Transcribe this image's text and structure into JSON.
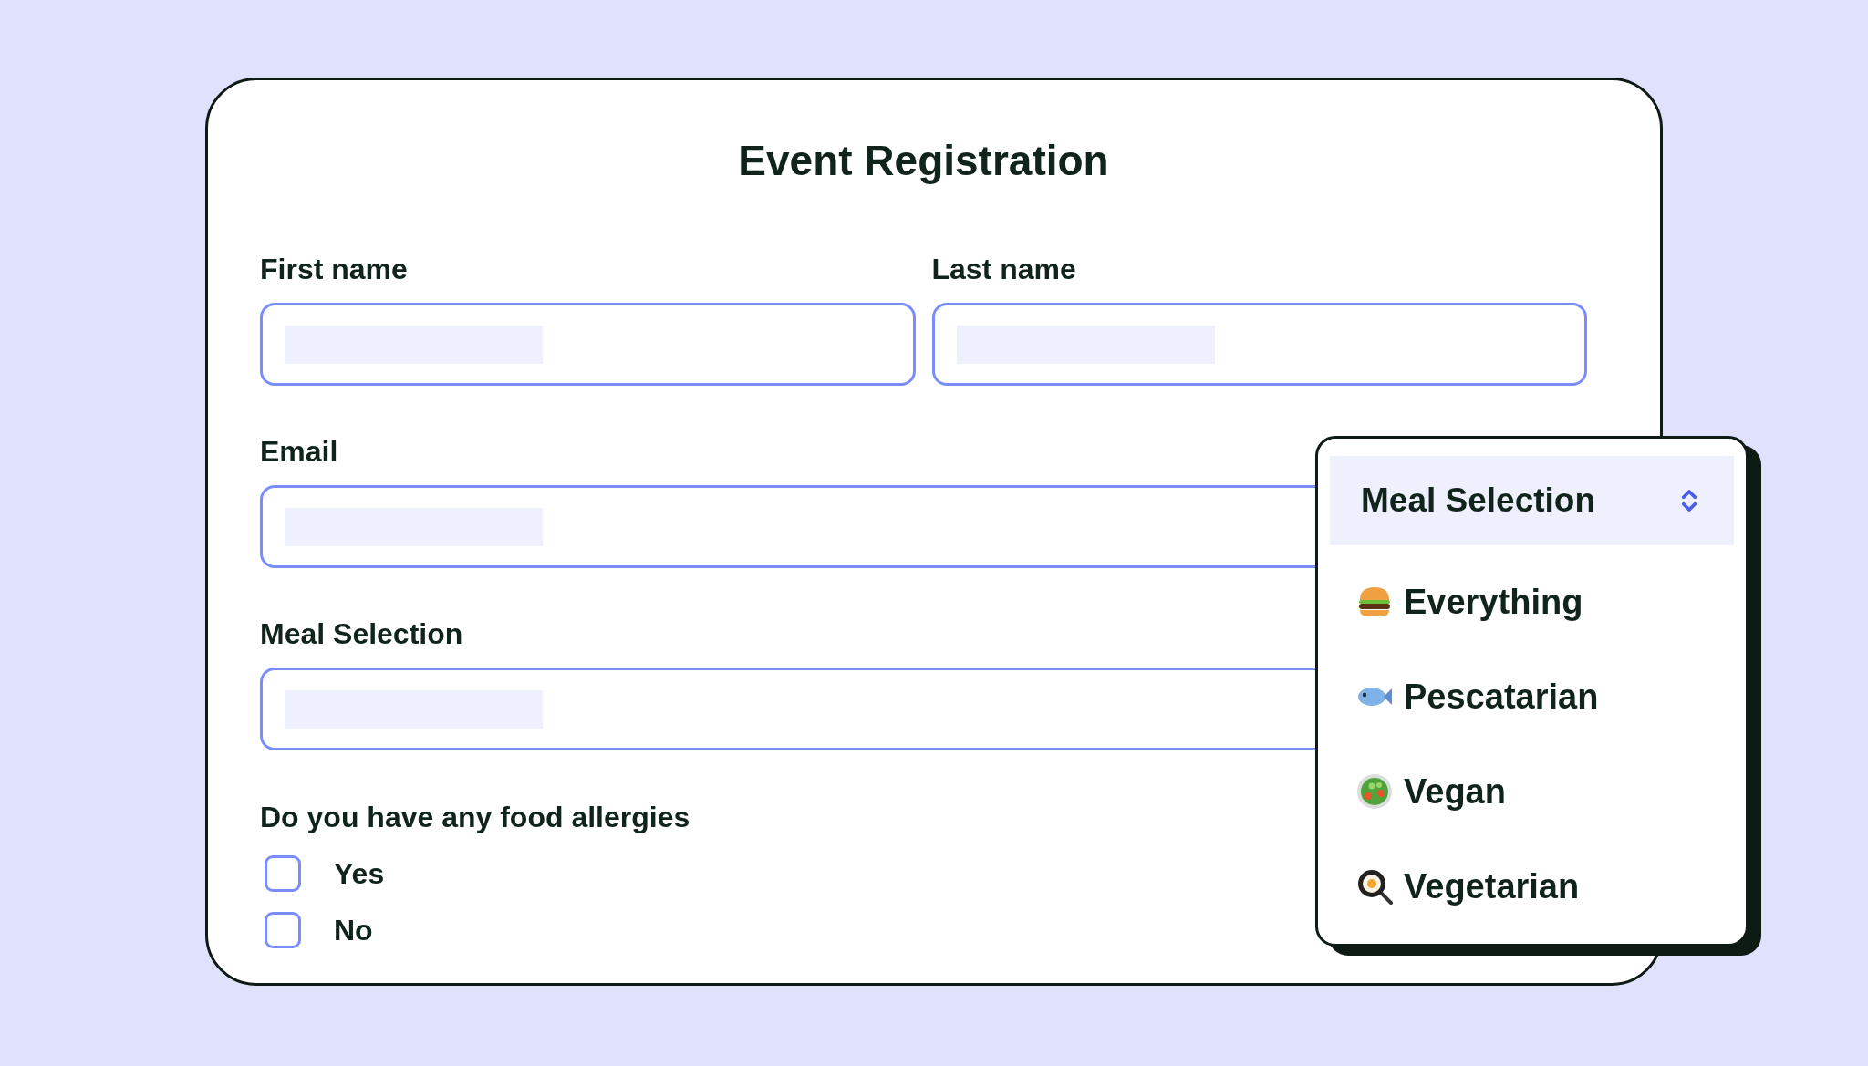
{
  "title": "Event Registration",
  "name_fields": [
    {
      "label": "First name"
    },
    {
      "label": "Last name"
    }
  ],
  "fields": [
    {
      "label": "Email"
    },
    {
      "label": "Meal Selection"
    }
  ],
  "question": {
    "label": "Do you have any food allergies",
    "options": [
      {
        "label": "Yes",
        "checked": false
      },
      {
        "label": "No",
        "checked": false
      }
    ]
  },
  "dropdown": {
    "value": "Meal Selection",
    "expanded": true,
    "options": [
      "Everything",
      "Pescatarian",
      "Vegan",
      "Vegetarian"
    ]
  }
}
